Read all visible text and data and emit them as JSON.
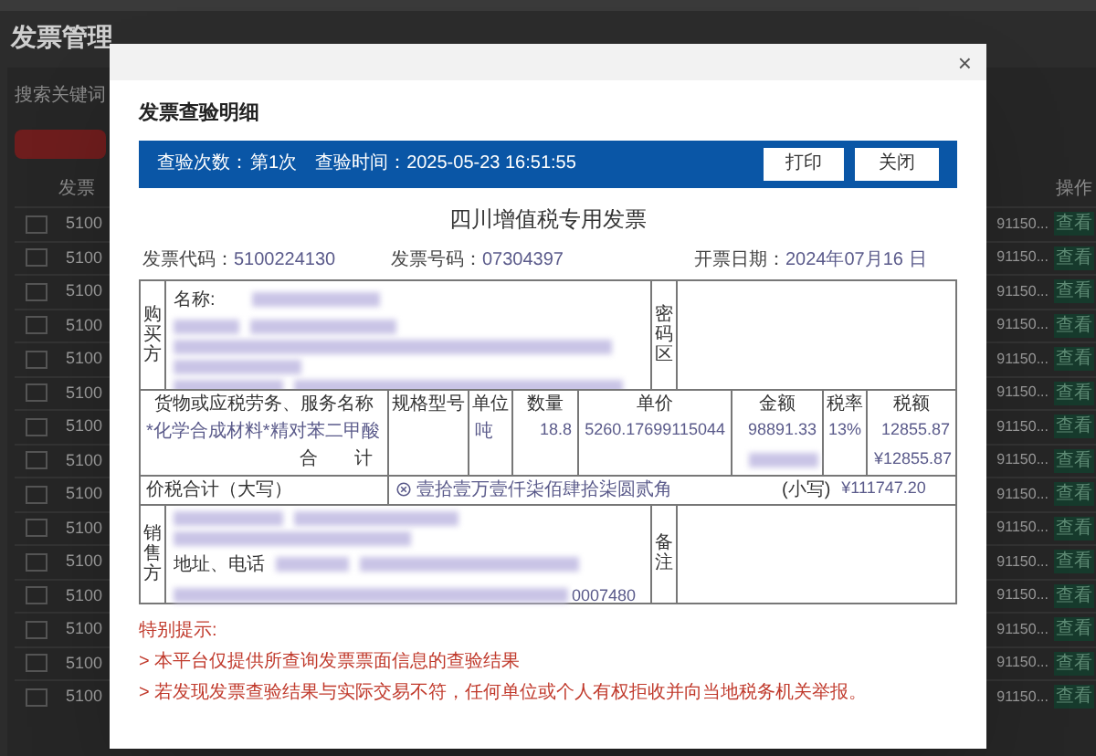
{
  "page": {
    "title": "发票管理",
    "search_label": "搜索关键词",
    "columns": [
      {
        "label": "发票"
      },
      {
        "label": "操作"
      }
    ],
    "rows": [
      {
        "checked": false,
        "code": "5100",
        "buyer": "91150...",
        "action": "查看"
      },
      {
        "checked": false,
        "code": "5100",
        "buyer": "91150...",
        "action": "查看"
      },
      {
        "checked": false,
        "code": "5100",
        "buyer": "91150...",
        "action": "查看"
      },
      {
        "checked": false,
        "code": "5100",
        "buyer": "91150...",
        "action": "查看"
      },
      {
        "checked": false,
        "code": "5100",
        "buyer": "91150...",
        "action": "查看"
      },
      {
        "checked": false,
        "code": "5100",
        "buyer": "91150...",
        "action": "查看"
      },
      {
        "checked": false,
        "code": "5100",
        "buyer": "91150...",
        "action": "查看"
      },
      {
        "checked": false,
        "code": "5100",
        "buyer": "91150...",
        "action": "查看"
      },
      {
        "checked": false,
        "code": "5100",
        "buyer": "91150...",
        "action": "查看"
      },
      {
        "checked": false,
        "code": "5100",
        "buyer": "91150...",
        "action": "查看"
      },
      {
        "checked": false,
        "code": "5100",
        "buyer": "91150...",
        "action": "查看"
      },
      {
        "checked": false,
        "code": "5100",
        "buyer": "91150...",
        "action": "查看"
      },
      {
        "checked": false,
        "code": "5100",
        "buyer": "91150...",
        "action": "查看"
      },
      {
        "checked": false,
        "code": "5100",
        "buyer": "91150...",
        "action": "查看"
      },
      {
        "checked": false,
        "code": "5100",
        "buyer": "91150...",
        "action": "查看"
      }
    ]
  },
  "dialog": {
    "close_icon": "×",
    "title": "发票查验明细",
    "status_bar": {
      "count_label": "查验次数：",
      "count": "第1次",
      "time_label": "查验时间：",
      "time": "2025-05-23 16:51:55",
      "buttons": [
        "打印",
        "关闭"
      ]
    },
    "invoice": {
      "title": "四川增值税专用发票",
      "header": [
        {
          "label": "发票代码：",
          "value": "5100224130"
        },
        {
          "label": "发票号码：",
          "value": "07304397"
        },
        {
          "label": "开票日期：",
          "value": "2024年07月16 日"
        }
      ],
      "buyer": {
        "side_label": "购买方",
        "name_label": "名称:",
        "cipher_label": "密码区"
      },
      "columns": [
        "货物或应税劳务、服务名称",
        "规格型号",
        "单位",
        "数量",
        "单价",
        "金额",
        "税率",
        "税额"
      ],
      "items": [
        {
          "name": "*化学合成材料*精对苯二甲酸",
          "unit": "吨",
          "quantity": "18.8",
          "unit_price": "5260.17699115044",
          "amount": "98891.33",
          "tax_rate": "13%",
          "tax": "12855.87"
        }
      ],
      "total_label": "合　　计",
      "total_tax": "¥12855.87",
      "grand_total": {
        "label": "价税合计（大写）",
        "words": "壹拾壹万壹仟柒佰肆拾柒圆贰角",
        "small_label": "(小写)",
        "amount": "¥111747.20"
      },
      "seller": {
        "side_label": "销售方",
        "address_label": "地址、电话",
        "account_tail": "0007480",
        "remark_label": "备注"
      }
    },
    "notes": {
      "title": "特别提示:",
      "lines": [
        "> 本平台仅提供所查询发票票面信息的查验结果",
        "> 若发现发票查验结果与实际交易不符，任何单位或个人有权拒收并向当地税务机关举报。"
      ]
    }
  }
}
